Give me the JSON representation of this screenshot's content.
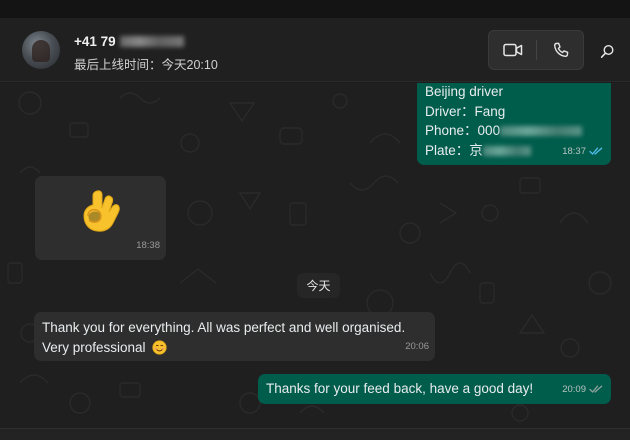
{
  "header": {
    "contact_name": "+41 79",
    "last_seen": "最后上线时间：今天20:10",
    "buttons": {
      "video_icon": "video-camera-icon",
      "voice_icon": "phone-icon",
      "search_icon": "search-icon"
    }
  },
  "messages": [
    {
      "direction": "outgoing",
      "lines": [
        "Beijing driver",
        "Driver：Fang",
        "Phone：",
        "Plate："
      ],
      "phone_visible": "000",
      "plate_visible": "京",
      "time": "18:37",
      "status": "read"
    },
    {
      "direction": "incoming",
      "emoji": "👌",
      "time": "18:38"
    },
    {
      "direction": "incoming",
      "text": "Thank you for everything. All was perfect and well organised. Very professional",
      "emoji": "☺️",
      "time": "20:06"
    },
    {
      "direction": "outgoing",
      "text": "Thanks for your feed back, have a good day!",
      "time": "20:09",
      "status": "read"
    }
  ],
  "date_separator": "今天",
  "colors": {
    "background": "#1f1f1f",
    "header": "#202020",
    "outgoing_bubble": "#005c4b",
    "incoming_bubble": "#2e2e2e",
    "read_ticks": "#53bdeb"
  }
}
